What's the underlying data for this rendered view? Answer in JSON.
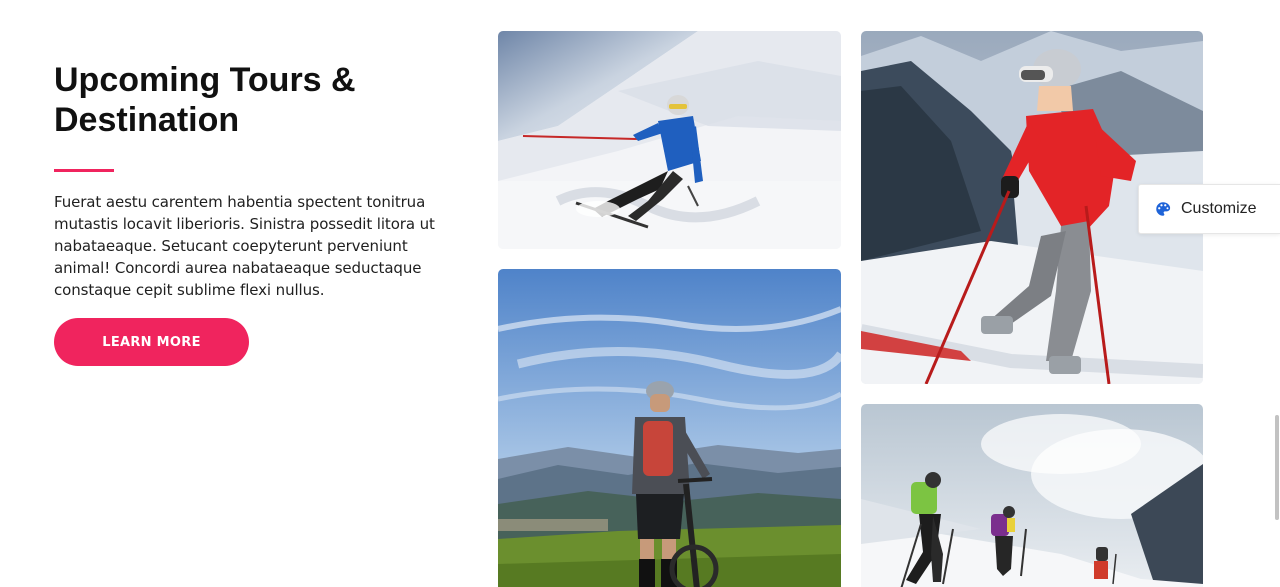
{
  "section": {
    "title_line1": "Upcoming Tours &",
    "title_line2": "Destination",
    "description": "Fuerat aestu carentem habentia spectent tonitrua mutastis locavit liberioris. Sinistra possedit litora ut nabataeaque. Setucant coepyterunt perveniunt animal! Concordi aurea nabataeaque seductaque constaque cepit sublime flexi nullus.",
    "button_label": "LEARN MORE"
  },
  "gallery": [
    {
      "subject": "skier-descending-slope"
    },
    {
      "subject": "mountain-biker-overlooking-valley"
    },
    {
      "subject": "skier-in-red-jacket"
    },
    {
      "subject": "hikers-climbing-snowy-ridge"
    }
  ],
  "customize": {
    "label": "Customize",
    "icon": "palette-icon"
  },
  "colors": {
    "accent": "#f0245e",
    "heading": "#111111",
    "body_text": "#1f1f1f"
  }
}
